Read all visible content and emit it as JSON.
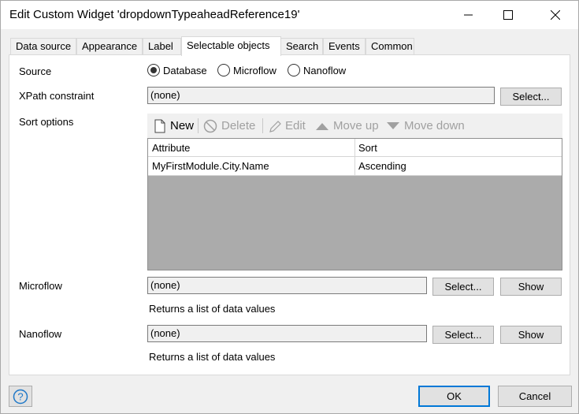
{
  "window": {
    "title": "Edit Custom Widget 'dropdownTypeaheadReference19'"
  },
  "tabs": [
    {
      "label": "Data source"
    },
    {
      "label": "Appearance"
    },
    {
      "label": "Label"
    },
    {
      "label": "Selectable objects",
      "active": true
    },
    {
      "label": "Search"
    },
    {
      "label": "Events"
    },
    {
      "label": "Common"
    }
  ],
  "source": {
    "label": "Source",
    "options": [
      {
        "label": "Database",
        "checked": true
      },
      {
        "label": "Microflow",
        "checked": false
      },
      {
        "label": "Nanoflow",
        "checked": false
      }
    ]
  },
  "xpath": {
    "label": "XPath constraint",
    "value": "(none)",
    "select_label": "Select..."
  },
  "sort": {
    "label": "Sort options",
    "toolbar": {
      "new": "New",
      "delete": "Delete",
      "edit": "Edit",
      "move_up": "Move up",
      "move_down": "Move down"
    },
    "columns": [
      "Attribute",
      "Sort"
    ],
    "rows": [
      [
        "MyFirstModule.City.Name",
        "Ascending"
      ]
    ]
  },
  "microflow": {
    "label": "Microflow",
    "value": "(none)",
    "select_label": "Select...",
    "show_label": "Show",
    "hint": "Returns a list of data values"
  },
  "nanoflow": {
    "label": "Nanoflow",
    "value": "(none)",
    "select_label": "Select...",
    "show_label": "Show",
    "hint": "Returns a list of data values"
  },
  "footer": {
    "ok_label": "OK",
    "cancel_label": "Cancel"
  },
  "colors": {
    "accent": "#0078d7"
  }
}
